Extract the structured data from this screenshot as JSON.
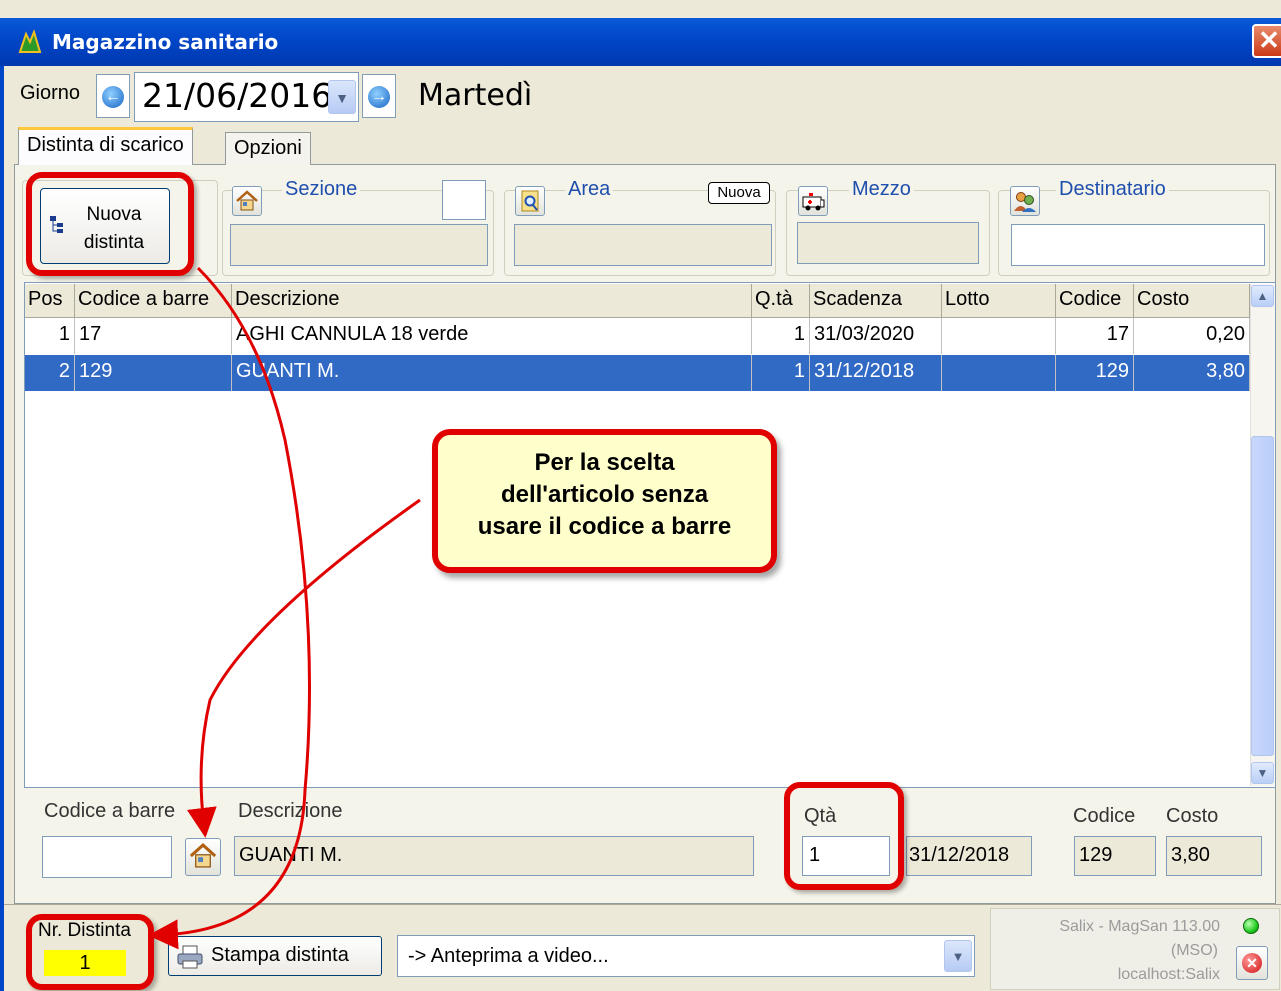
{
  "window": {
    "title": "Magazzino sanitario",
    "close_glyph": "✕"
  },
  "date_row": {
    "label": "Giorno",
    "date": "21/06/2016",
    "day_name": "Martedì"
  },
  "tabs": [
    {
      "label": "Distinta di scarico"
    },
    {
      "label": "Opzioni"
    }
  ],
  "toolbar": {
    "nuova_distinta_label_1": "Nuova",
    "nuova_distinta_label_2": "distinta",
    "sezione_title": "Sezione",
    "area_title": "Area",
    "area_new_button": "Nuova",
    "mezzo_title": "Mezzo",
    "destinatario_title": "Destinatario"
  },
  "table": {
    "headers": [
      "Pos",
      "Codice a barre",
      "Descrizione",
      "Q.tà",
      "Scadenza",
      "Lotto",
      "Codice",
      "Costo"
    ],
    "rows": [
      {
        "pos": "1",
        "barcode": "17",
        "descr": "AGHI CANNULA 18 verde",
        "qty": "1",
        "expiry": "31/03/2020",
        "lot": "",
        "code": "17",
        "cost": "0,20",
        "selected": false
      },
      {
        "pos": "2",
        "barcode": "129",
        "descr": "GUANTI M.",
        "qty": "1",
        "expiry": "31/12/2018",
        "lot": "",
        "code": "129",
        "cost": "3,80",
        "selected": true
      }
    ]
  },
  "callout": {
    "line1": "Per la scelta",
    "line2": "dell'articolo senza",
    "line3": "usare il codice a barre"
  },
  "detail": {
    "barcode_label": "Codice a barre",
    "barcode_value": "",
    "descr_label": "Descrizione",
    "descr_value": "GUANTI M.",
    "qty_label": "Qtà",
    "qty_value": "1",
    "expiry_value": "31/12/2018",
    "code_label": "Codice",
    "code_value": "129",
    "cost_label": "Costo",
    "cost_value": "3,80"
  },
  "footer": {
    "nr_label": "Nr. Distinta",
    "nr_value": "1",
    "print_button": "Stampa distinta",
    "print_target": "-> Anteprima a video...",
    "status_line1": "Salix - MagSan 113.00",
    "status_line2": "(MSO)",
    "status_line3": "localhost:Salix"
  },
  "colors": {
    "title_bar": "#0046c8",
    "selection": "#316ac5",
    "highlight_red": "#e00000",
    "callout_bg": "#ffffcc",
    "nr_bg": "#ffff00",
    "status_led": "#22cc22"
  }
}
